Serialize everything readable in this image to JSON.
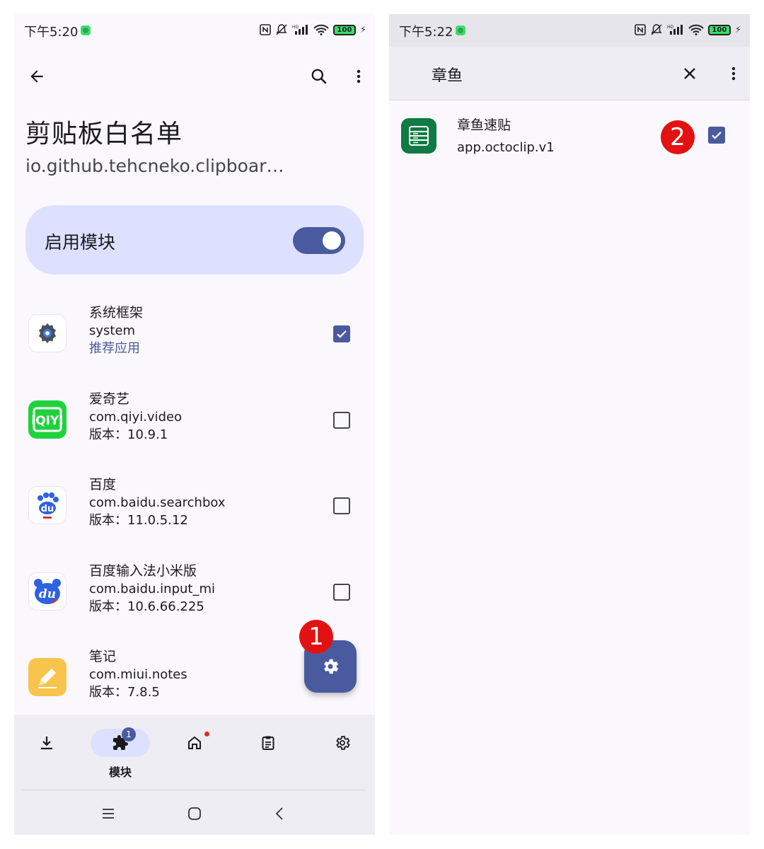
{
  "left": {
    "status": {
      "time": "下午5:20",
      "battery": "100"
    },
    "title": "剪贴板白名单",
    "subtitle": "io.github.tehcneko.clipboar…",
    "enable_label": "启用模块",
    "enable_on": true,
    "apps": [
      {
        "name": "系统框架",
        "package": "system",
        "extra": "推荐应用",
        "extra_type": "tag",
        "checked": true,
        "icon": "system-gear-icon"
      },
      {
        "name": "爱奇艺",
        "package": "com.qiyi.video",
        "extra": "版本：10.9.1",
        "extra_type": "version",
        "checked": false,
        "icon": "iqiyi-icon"
      },
      {
        "name": "百度",
        "package": "com.baidu.searchbox",
        "extra": "版本：11.0.5.12",
        "extra_type": "version",
        "checked": false,
        "icon": "baidu-icon"
      },
      {
        "name": "百度输入法小米版",
        "package": "com.baidu.input_mi",
        "extra": "版本：10.6.66.225",
        "extra_type": "version",
        "checked": false,
        "icon": "baidu-input-icon"
      },
      {
        "name": "笔记",
        "package": "com.miui.notes",
        "extra": "版本：7.8.5",
        "extra_type": "version",
        "checked": false,
        "icon": "notes-icon"
      }
    ],
    "annotation_1": "1",
    "nav": {
      "items": [
        {
          "id": "download",
          "icon": "download-icon"
        },
        {
          "id": "modules",
          "icon": "puzzle-icon",
          "label": "模块",
          "badge": "1",
          "active": true
        },
        {
          "id": "home",
          "icon": "home-icon"
        },
        {
          "id": "logs",
          "icon": "clipboard-icon"
        },
        {
          "id": "settings",
          "icon": "gear-icon"
        }
      ]
    }
  },
  "right": {
    "status": {
      "time": "下午5:22",
      "battery": "100"
    },
    "search_query": "章鱼",
    "result": {
      "name": "章鱼速贴",
      "package": "app.octoclip.v1",
      "checked": true,
      "icon": "octoclip-icon"
    },
    "annotation_2": "2"
  },
  "colors": {
    "accent": "#4a5a9e",
    "card": "#dde1ff",
    "annotation": "#e31212"
  }
}
